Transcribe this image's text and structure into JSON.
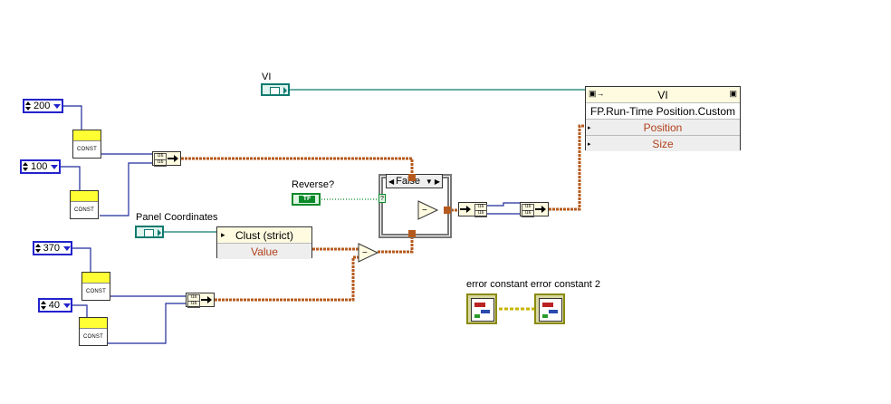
{
  "vi_label": "VI",
  "property_node": {
    "title": "VI",
    "class_path": "FP.Run-Time Position.Custom",
    "properties": [
      "Position",
      "Size"
    ]
  },
  "constants": [
    "200",
    "100",
    "370",
    "40"
  ],
  "subvi_text": "CONST",
  "reverse_label": "Reverse?",
  "bool_text": "TF",
  "panel_label": "Panel Coordinates",
  "unbundle": {
    "title": "Clust (strict)",
    "field": "Value"
  },
  "case_selector": "False",
  "bundle_text": "I16",
  "error_labels": "error constant error constant 2",
  "colors": {
    "orange_wire": "#b55a1e",
    "blue_wire": "#1f2a9a",
    "teal_wire": "#0f7a6f",
    "green_wire": "#0a8a2a",
    "error_wire": "#c8b400"
  }
}
